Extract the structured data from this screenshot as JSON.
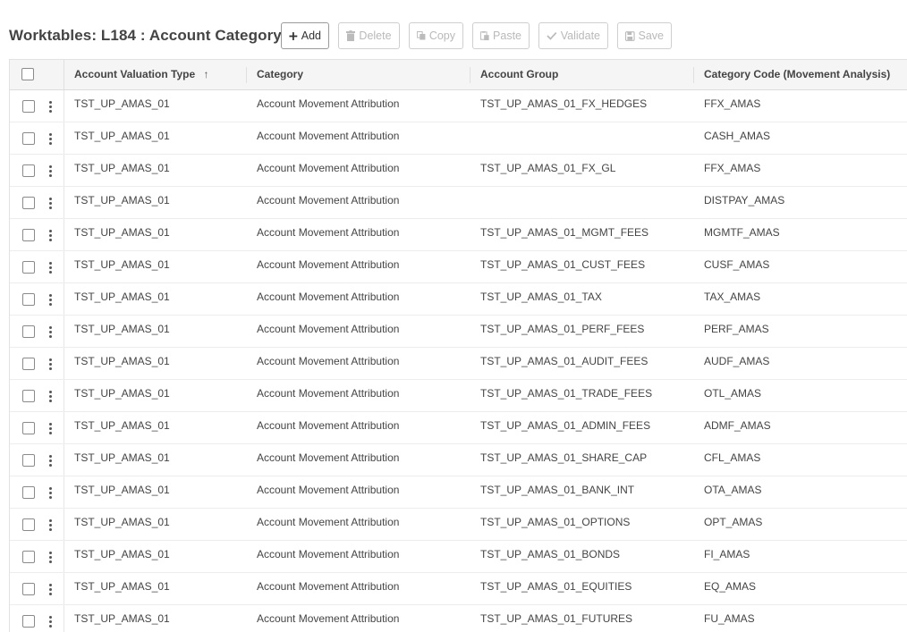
{
  "page": {
    "title": "Worktables: L184 : Account Category"
  },
  "toolbar": {
    "add_label": "Add",
    "delete_label": "Delete",
    "copy_label": "Copy",
    "paste_label": "Paste",
    "validate_label": "Validate",
    "save_label": "Save"
  },
  "grid": {
    "columns": [
      {
        "label": "Account Valuation Type",
        "sort": "ascending",
        "sort_icon": "arrow-up-icon"
      },
      {
        "label": "Category"
      },
      {
        "label": "Account Group"
      },
      {
        "label": "Category Code (Movement Analysis)"
      }
    ],
    "rows": [
      {
        "valuation_type": "TST_UP_AMAS_01",
        "category": "Account Movement Attribution",
        "group": "TST_UP_AMAS_01_FX_HEDGES",
        "code": "FFX_AMAS"
      },
      {
        "valuation_type": "TST_UP_AMAS_01",
        "category": "Account Movement Attribution",
        "group": "",
        "code": "CASH_AMAS"
      },
      {
        "valuation_type": "TST_UP_AMAS_01",
        "category": "Account Movement Attribution",
        "group": "TST_UP_AMAS_01_FX_GL",
        "code": "FFX_AMAS"
      },
      {
        "valuation_type": "TST_UP_AMAS_01",
        "category": "Account Movement Attribution",
        "group": "",
        "code": "DISTPAY_AMAS"
      },
      {
        "valuation_type": "TST_UP_AMAS_01",
        "category": "Account Movement Attribution",
        "group": "TST_UP_AMAS_01_MGMT_FEES",
        "code": "MGMTF_AMAS"
      },
      {
        "valuation_type": "TST_UP_AMAS_01",
        "category": "Account Movement Attribution",
        "group": "TST_UP_AMAS_01_CUST_FEES",
        "code": "CUSF_AMAS"
      },
      {
        "valuation_type": "TST_UP_AMAS_01",
        "category": "Account Movement Attribution",
        "group": "TST_UP_AMAS_01_TAX",
        "code": "TAX_AMAS"
      },
      {
        "valuation_type": "TST_UP_AMAS_01",
        "category": "Account Movement Attribution",
        "group": "TST_UP_AMAS_01_PERF_FEES",
        "code": "PERF_AMAS"
      },
      {
        "valuation_type": "TST_UP_AMAS_01",
        "category": "Account Movement Attribution",
        "group": "TST_UP_AMAS_01_AUDIT_FEES",
        "code": "AUDF_AMAS"
      },
      {
        "valuation_type": "TST_UP_AMAS_01",
        "category": "Account Movement Attribution",
        "group": "TST_UP_AMAS_01_TRADE_FEES",
        "code": "OTL_AMAS"
      },
      {
        "valuation_type": "TST_UP_AMAS_01",
        "category": "Account Movement Attribution",
        "group": "TST_UP_AMAS_01_ADMIN_FEES",
        "code": "ADMF_AMAS"
      },
      {
        "valuation_type": "TST_UP_AMAS_01",
        "category": "Account Movement Attribution",
        "group": "TST_UP_AMAS_01_SHARE_CAP",
        "code": "CFL_AMAS"
      },
      {
        "valuation_type": "TST_UP_AMAS_01",
        "category": "Account Movement Attribution",
        "group": "TST_UP_AMAS_01_BANK_INT",
        "code": "OTA_AMAS"
      },
      {
        "valuation_type": "TST_UP_AMAS_01",
        "category": "Account Movement Attribution",
        "group": "TST_UP_AMAS_01_OPTIONS",
        "code": "OPT_AMAS"
      },
      {
        "valuation_type": "TST_UP_AMAS_01",
        "category": "Account Movement Attribution",
        "group": "TST_UP_AMAS_01_BONDS",
        "code": "FI_AMAS"
      },
      {
        "valuation_type": "TST_UP_AMAS_01",
        "category": "Account Movement Attribution",
        "group": "TST_UP_AMAS_01_EQUITIES",
        "code": "EQ_AMAS"
      },
      {
        "valuation_type": "TST_UP_AMAS_01",
        "category": "Account Movement Attribution",
        "group": "TST_UP_AMAS_01_FUTURES",
        "code": "FU_AMAS"
      }
    ]
  }
}
